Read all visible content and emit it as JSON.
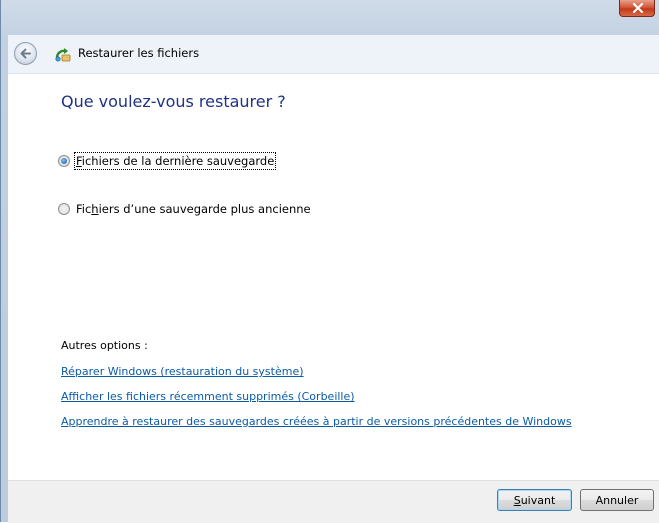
{
  "window": {
    "title": "Restaurer les fichiers",
    "close_icon": "close-icon",
    "back_icon": "back-arrow-icon",
    "title_icon": "restore-files-icon"
  },
  "main": {
    "heading": "Que voulez-vous restaurer ?",
    "options": [
      {
        "mnemonic": "F",
        "rest": "ichiers de la dernière sauvegarde",
        "checked": true
      },
      {
        "pre": "Fic",
        "mnemonic": "h",
        "rest": "iers d’une sauvegarde plus ancienne",
        "checked": false
      }
    ],
    "other_options_label": "Autres options :",
    "links": [
      "Réparer Windows (restauration du système)",
      "Afficher les fichiers récemment supprimés (Corbeille)",
      "Apprendre à restaurer des sauvegardes créées à partir de versions précédentes de Windows"
    ]
  },
  "footer": {
    "next_mnemonic": "S",
    "next_rest": "uivant",
    "cancel_label": "Annuler"
  },
  "colors": {
    "heading": "#1e3287",
    "link": "#0c5ba6",
    "close_button": "#c23a1a"
  }
}
